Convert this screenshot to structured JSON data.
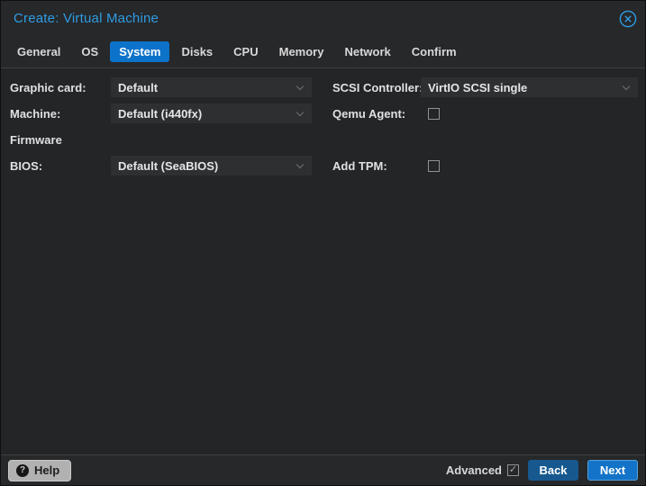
{
  "window": {
    "title": "Create: Virtual Machine"
  },
  "tabs": [
    {
      "label": "General",
      "active": false
    },
    {
      "label": "OS",
      "active": false
    },
    {
      "label": "System",
      "active": true
    },
    {
      "label": "Disks",
      "active": false
    },
    {
      "label": "CPU",
      "active": false
    },
    {
      "label": "Memory",
      "active": false
    },
    {
      "label": "Network",
      "active": false
    },
    {
      "label": "Confirm",
      "active": false
    }
  ],
  "form": {
    "left": [
      {
        "label": "Graphic card:",
        "type": "select",
        "value": "Default"
      },
      {
        "label": "Machine:",
        "type": "select",
        "value": "Default (i440fx)"
      },
      {
        "label": "Firmware",
        "type": "section"
      },
      {
        "label": "BIOS:",
        "type": "select",
        "value": "Default (SeaBIOS)"
      }
    ],
    "right": [
      {
        "label": "SCSI Controller:",
        "type": "select",
        "value": "VirtIO SCSI single"
      },
      {
        "label": "Qemu Agent:",
        "type": "checkbox",
        "checked": false,
        "glyph": ""
      },
      {
        "label": "Add TPM:",
        "type": "checkbox",
        "checked": false,
        "glyph": ""
      }
    ]
  },
  "footer": {
    "help_label": "Help",
    "help_icon_glyph": "?",
    "advanced_label": "Advanced",
    "advanced_checked": true,
    "advanced_check_glyph": "✓",
    "back_label": "Back",
    "next_label": "Next"
  },
  "icons": {
    "close": "circle-x",
    "dropdown": "chevron-down",
    "help": "question-mark-circle",
    "checkbox_check": "✓"
  },
  "colors": {
    "title_blue": "#2f9ce3",
    "active_tab_blue": "#0d72c9",
    "next_button_blue": "#1273c8",
    "back_button_blue": "#17598f",
    "help_button_gray": "#b1b1b1",
    "panel_background": "#232526",
    "header_background": "#26282a",
    "field_background": "#2d2f31"
  }
}
